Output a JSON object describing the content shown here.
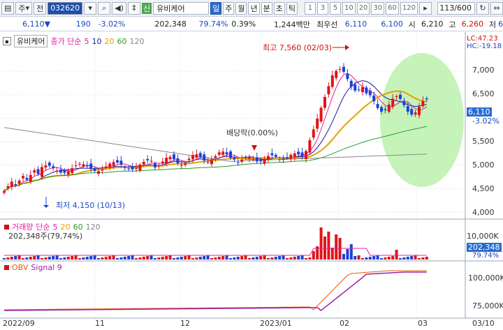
{
  "toolbar": {
    "market": "주",
    "prev_label": "전",
    "code": "032620",
    "badge": "신",
    "stock_name": "유비케어",
    "periods": [
      "일",
      "주",
      "월",
      "년",
      "분",
      "초",
      "틱"
    ],
    "active_period": "일",
    "minute_options": [
      "1",
      "3",
      "5",
      "10",
      "20",
      "30",
      "60",
      "120"
    ],
    "page_count": "113/600"
  },
  "infobar": {
    "price": "6,110",
    "change": "190",
    "change_pct": "-3.02%",
    "volume": "202,348",
    "volume_ratio": "79.74%",
    "turnover": "0.39%",
    "trade_amount": "1,244백만",
    "priority_label": "최우선",
    "ask": "6,110",
    "bid": "6,100",
    "open_label": "시",
    "open": "6,210",
    "high_label": "고",
    "high": "6,260",
    "low_label": "저",
    "low": "6"
  },
  "price_panel": {
    "stock_label": "유비케어",
    "ma_title": "종가 단순",
    "ma_periods": [
      "5",
      "10",
      "20",
      "60",
      "120"
    ],
    "lc": "LC:47.23",
    "hc": "HC:-19.18",
    "current_price": "6,110",
    "current_change": "-3.02%",
    "high_annotation": "최고 7,560 (02/03)",
    "low_annotation": "최저 4,150 (10/13)",
    "dividend_annotation": "배당락(0.00%)",
    "y_ticks": [
      "7,000",
      "6,500",
      "6,000",
      "5,500",
      "5,000",
      "4,500",
      "4,000"
    ]
  },
  "volume_panel": {
    "title": "거래량",
    "ma_title": "단순",
    "ma_periods": [
      "5",
      "20",
      "60",
      "120"
    ],
    "summary": "202,348주(79,74%)",
    "y_tick": "10,000K",
    "current_volume": "202,348",
    "current_ratio": "79.74%"
  },
  "obv_panel": {
    "title": "OBV",
    "signal": "Signal 9",
    "y_ticks": [
      "100,000K",
      "75,000K"
    ]
  },
  "x_axis": [
    "2022/09",
    "11",
    "12",
    "2023/01",
    "02",
    "03",
    "03/10"
  ],
  "colors": {
    "up": "#e0151a",
    "down": "#1e40d8",
    "ma5": "#e020a0",
    "ma10": "#1a1aa0",
    "ma20": "#e8a000",
    "ma60": "#2a9a2a",
    "ma120": "#888888",
    "highlight": "#b8f0a8"
  }
}
